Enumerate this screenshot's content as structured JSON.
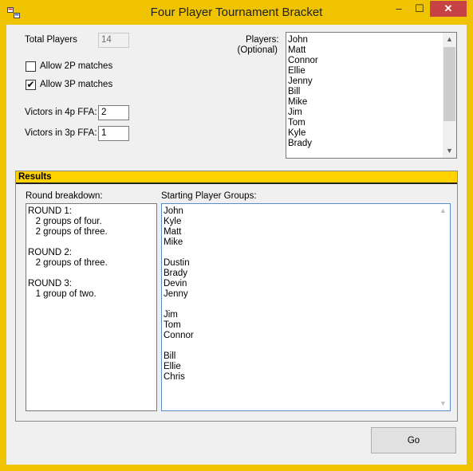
{
  "window": {
    "title": "Four Player Tournament Bracket",
    "min_glyph": "–",
    "max_glyph": "☐",
    "close_glyph": "✕"
  },
  "settings": {
    "total_players_label": "Total Players",
    "total_players_value": "14",
    "allow_2p_label": "Allow 2P matches",
    "allow_2p_checked": false,
    "allow_3p_label": "Allow 3P matches",
    "allow_3p_checked": true,
    "victors_4p_label": "Victors in 4p FFA:",
    "victors_4p_value": "2",
    "victors_3p_label": "Victors in 3p FFA:",
    "victors_3p_value": "1"
  },
  "players": {
    "label_line1": "Players:",
    "label_line2": "(Optional)",
    "items": [
      "John",
      "Matt",
      "Connor",
      "Ellie",
      "Jenny",
      "Bill",
      "Mike",
      "Jim",
      "Tom",
      "Kyle",
      "Brady"
    ]
  },
  "results": {
    "header": "Results",
    "round_breakdown_label": "Round breakdown:",
    "round_breakdown_lines": [
      "ROUND 1:",
      "   2 groups of four.",
      "   2 groups of three.",
      "",
      "ROUND 2:",
      "   2 groups of three.",
      "",
      "ROUND 3:",
      "   1 group of two."
    ],
    "starting_groups_label": "Starting Player Groups:",
    "starting_groups_lines": [
      "John",
      "Kyle",
      "Matt",
      "Mike",
      "",
      "Dustin",
      "Brady",
      "Devin",
      "Jenny",
      "",
      "Jim",
      "Tom",
      "Connor",
      "",
      "Bill",
      "Ellie",
      "Chris"
    ]
  },
  "actions": {
    "go_label": "Go"
  },
  "colors": {
    "accent": "#f0c300",
    "results_header": "#ffd200",
    "close": "#c74343"
  }
}
